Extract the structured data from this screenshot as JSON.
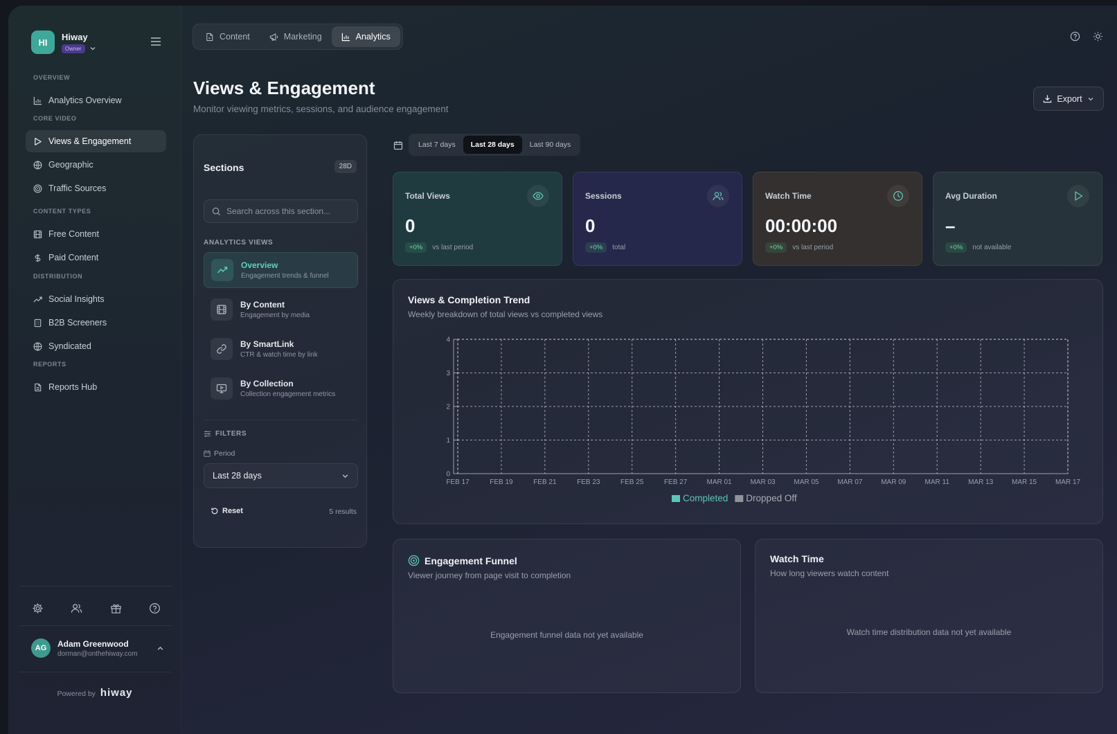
{
  "brand": {
    "initials": "HI",
    "name": "Hiway",
    "role": "Owner"
  },
  "sidebar": {
    "sections": {
      "overview": "OVERVIEW",
      "core_video": "CORE VIDEO",
      "content_types": "CONTENT TYPES",
      "distribution": "DISTRIBUTION",
      "reports": "REPORTS"
    },
    "items": [
      {
        "label": "Analytics Overview",
        "icon": "bar-chart-icon"
      },
      {
        "label": "Views & Engagement",
        "icon": "play-icon",
        "active": true
      },
      {
        "label": "Geographic",
        "icon": "globe-icon"
      },
      {
        "label": "Traffic Sources",
        "icon": "target-icon"
      },
      {
        "label": "Free Content",
        "icon": "film-icon"
      },
      {
        "label": "Paid Content",
        "icon": "dollar-icon"
      },
      {
        "label": "Social Insights",
        "icon": "trend-up-icon"
      },
      {
        "label": "B2B Screeners",
        "icon": "building-icon"
      },
      {
        "label": "Syndicated",
        "icon": "globe-icon"
      },
      {
        "label": "Reports Hub",
        "icon": "file-icon"
      }
    ]
  },
  "user": {
    "initials": "AG",
    "name": "Adam Greenwood",
    "email": "dorman@onthehiway.com"
  },
  "powered": {
    "label": "Powered by",
    "logo": "hiway"
  },
  "top_tabs": [
    {
      "label": "Content",
      "icon": "file-icon"
    },
    {
      "label": "Marketing",
      "icon": "megaphone-icon"
    },
    {
      "label": "Analytics",
      "icon": "bar-chart-icon",
      "active": true
    }
  ],
  "page": {
    "title": "Views & Engagement",
    "subtitle": "Monitor viewing metrics, sessions, and audience engagement",
    "export_label": "Export"
  },
  "sections_panel": {
    "title": "Sections",
    "badge": "28D",
    "search_placeholder": "Search across this section...",
    "views_label": "ANALYTICS VIEWS",
    "views": [
      {
        "name": "Overview",
        "desc": "Engagement trends & funnel",
        "icon": "trend-up-icon",
        "active": true
      },
      {
        "name": "By Content",
        "desc": "Engagement by media",
        "icon": "film-icon"
      },
      {
        "name": "By SmartLink",
        "desc": "CTR & watch time by link",
        "icon": "link-icon"
      },
      {
        "name": "By Collection",
        "desc": "Collection engagement metrics",
        "icon": "monitor-play-icon"
      }
    ],
    "filters_label": "FILTERS",
    "period_label": "Period",
    "period_value": "Last 28 days",
    "reset_label": "Reset",
    "results": "5 results"
  },
  "date_range": {
    "options": [
      "Last 7 days",
      "Last 28 days",
      "Last 90 days"
    ],
    "selected": "Last 28 days"
  },
  "stats": [
    {
      "label": "Total Views",
      "value": "0",
      "delta": "+0%",
      "note": "vs last period",
      "icon": "eye-icon",
      "tint": "#1f3b3f"
    },
    {
      "label": "Sessions",
      "value": "0",
      "delta": "+0%",
      "note": "total",
      "icon": "users-icon",
      "tint": "#25284a"
    },
    {
      "label": "Watch Time",
      "value": "00:00:00",
      "delta": "+0%",
      "note": "vs last period",
      "icon": "clock-icon",
      "tint": "#33302f"
    },
    {
      "label": "Avg Duration",
      "value": "–",
      "delta": "+0%",
      "note": "not available",
      "icon": "play-icon",
      "tint": "#26333a"
    }
  ],
  "trend": {
    "title": "Views & Completion Trend",
    "subtitle": "Weekly breakdown of total views vs completed views"
  },
  "chart_data": {
    "type": "bar",
    "categories": [
      "FEB 17",
      "FEB 19",
      "FEB 21",
      "FEB 23",
      "FEB 25",
      "FEB 27",
      "MAR 01",
      "MAR 03",
      "MAR 05",
      "MAR 07",
      "MAR 09",
      "MAR 11",
      "MAR 13",
      "MAR 15",
      "MAR 17"
    ],
    "series": [
      {
        "name": "Completed",
        "values": [
          0,
          0,
          0,
          0,
          0,
          0,
          0,
          0,
          0,
          0,
          0,
          0,
          0,
          0,
          0
        ],
        "color": "#5fc4b8"
      },
      {
        "name": "Dropped Off",
        "values": [
          0,
          0,
          0,
          0,
          0,
          0,
          0,
          0,
          0,
          0,
          0,
          0,
          0,
          0,
          0
        ],
        "color": "#8e939c"
      }
    ],
    "yticks": [
      0,
      1,
      2,
      3,
      4
    ],
    "ylim": [
      0,
      4
    ],
    "grid": true,
    "legend": "bottom-center"
  },
  "funnel": {
    "title": "Engagement Funnel",
    "subtitle": "Viewer journey from page visit to completion",
    "empty": "Engagement funnel data not yet available"
  },
  "watch_time": {
    "title": "Watch Time",
    "subtitle": "How long viewers watch content",
    "empty": "Watch time distribution data not yet available"
  }
}
